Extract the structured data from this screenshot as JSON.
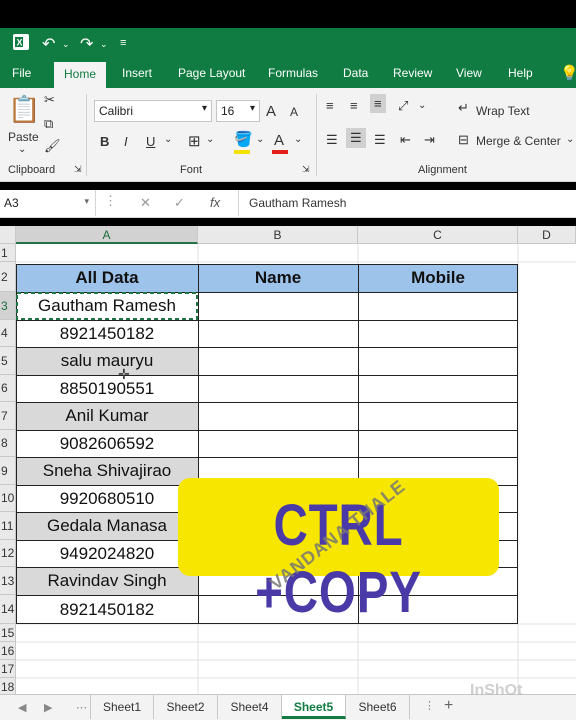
{
  "qat": {
    "excel_icon": "excel-logo-icon",
    "undo_icon": "undo-icon",
    "redo_icon": "redo-icon",
    "more_icon": "customize-icon"
  },
  "menu": {
    "tabs": [
      "File",
      "Home",
      "Insert",
      "Page Layout",
      "Formulas",
      "Data",
      "Review",
      "View",
      "Help"
    ],
    "active": "Home",
    "search_icon": "lightbulb-icon"
  },
  "ribbon": {
    "clipboard": {
      "paste_label": "Paste",
      "group_label": "Clipboard"
    },
    "font": {
      "font_name": "Calibri",
      "font_size": "16",
      "grow": "A",
      "shrink": "A",
      "bold": "B",
      "italic": "I",
      "underline": "U",
      "font_color_letter": "A",
      "group_label": "Font",
      "font_color": "#e31c1c",
      "fill_color": "#f5e000"
    },
    "alignment": {
      "wrap_text": "Wrap Text",
      "merge_center": "Merge & Center",
      "group_label": "Alignment"
    }
  },
  "formula_bar": {
    "name_box": "A3",
    "cancel": "✕",
    "enter": "✓",
    "fx": "fx",
    "formula": "Gautham Ramesh"
  },
  "sheet": {
    "columns": [
      "A",
      "B",
      "C",
      "D"
    ],
    "selected_column": "A",
    "rows": [
      "1",
      "2",
      "3",
      "4",
      "5",
      "6",
      "7",
      "8",
      "9",
      "10",
      "11",
      "12",
      "13",
      "14",
      "15",
      "16",
      "17",
      "18"
    ],
    "selected_row": "3",
    "header": {
      "a": "All Data",
      "b": "Name",
      "c": "Mobile"
    },
    "data": [
      "Gautham Ramesh",
      "8921450182",
      "salu mauryu",
      "8850190551",
      "Anil Kumar",
      "9082606592",
      "Sneha Shivajirao",
      "9920680510",
      "Gedala Manasa",
      "9492024820",
      "Ravindav Singh",
      "8921450182"
    ],
    "header_color": "#9ec3ea",
    "shade_color": "#d9d9d9"
  },
  "sheet_tabs": {
    "tabs": [
      "Sheet1",
      "Sheet2",
      "Sheet4",
      "Sheet5",
      "Sheet6"
    ],
    "active": "Sheet5",
    "add": "+"
  },
  "overlay": {
    "text": "CTRL +COPY",
    "watermark": "VANDANA THALE",
    "inshot": "InShOt"
  }
}
